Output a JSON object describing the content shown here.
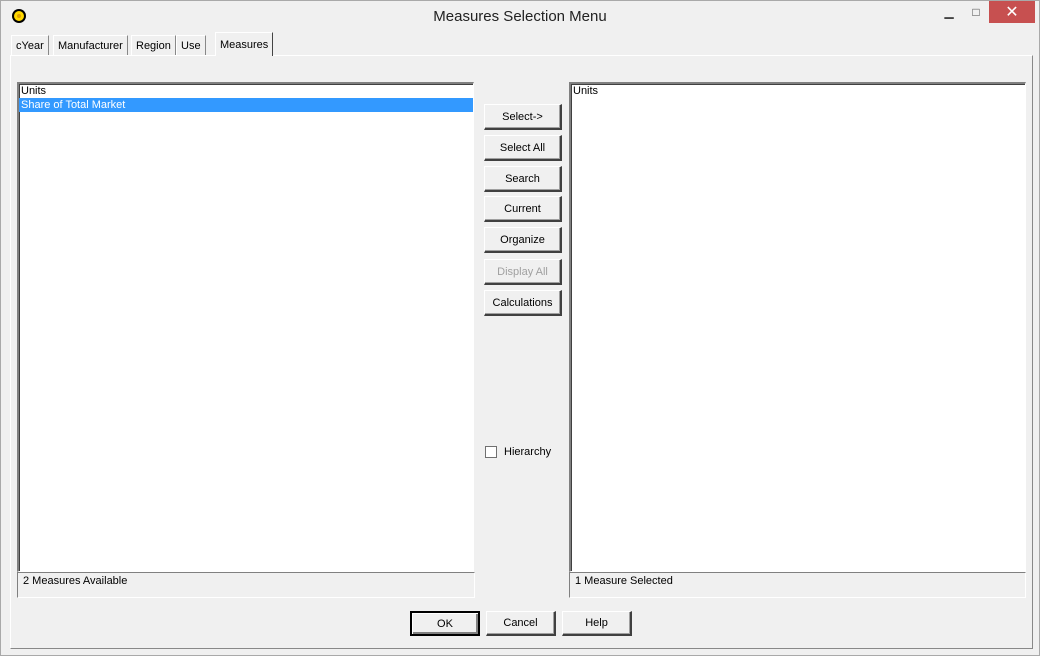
{
  "window": {
    "title": "Measures Selection Menu",
    "close_symbol": "✕",
    "min_symbol": "▁",
    "max_symbol": "□"
  },
  "tabs": [
    {
      "label": "cYear"
    },
    {
      "label": "Manufacturer"
    },
    {
      "label": "Region"
    },
    {
      "label": "Use"
    },
    {
      "label": "Measures",
      "active": true
    }
  ],
  "available": {
    "items": [
      "Units",
      "Share of Total Market"
    ],
    "selected_index": 1,
    "status": "2 Measures Available"
  },
  "selected": {
    "items": [
      "Units"
    ],
    "status": "1 Measure Selected"
  },
  "actions": {
    "select": "Select->",
    "select_all": "Select All",
    "search": "Search",
    "current": "Current",
    "organize": "Organize",
    "display_all": "Display All",
    "calculations": "Calculations"
  },
  "hierarchy": {
    "label": "Hierarchy",
    "checked": false
  },
  "footer": {
    "ok": "OK",
    "cancel": "Cancel",
    "help": "Help"
  },
  "colors": {
    "selection": "#3399ff",
    "close_button": "#c75050"
  },
  "icons": {
    "app": "sun-icon"
  }
}
